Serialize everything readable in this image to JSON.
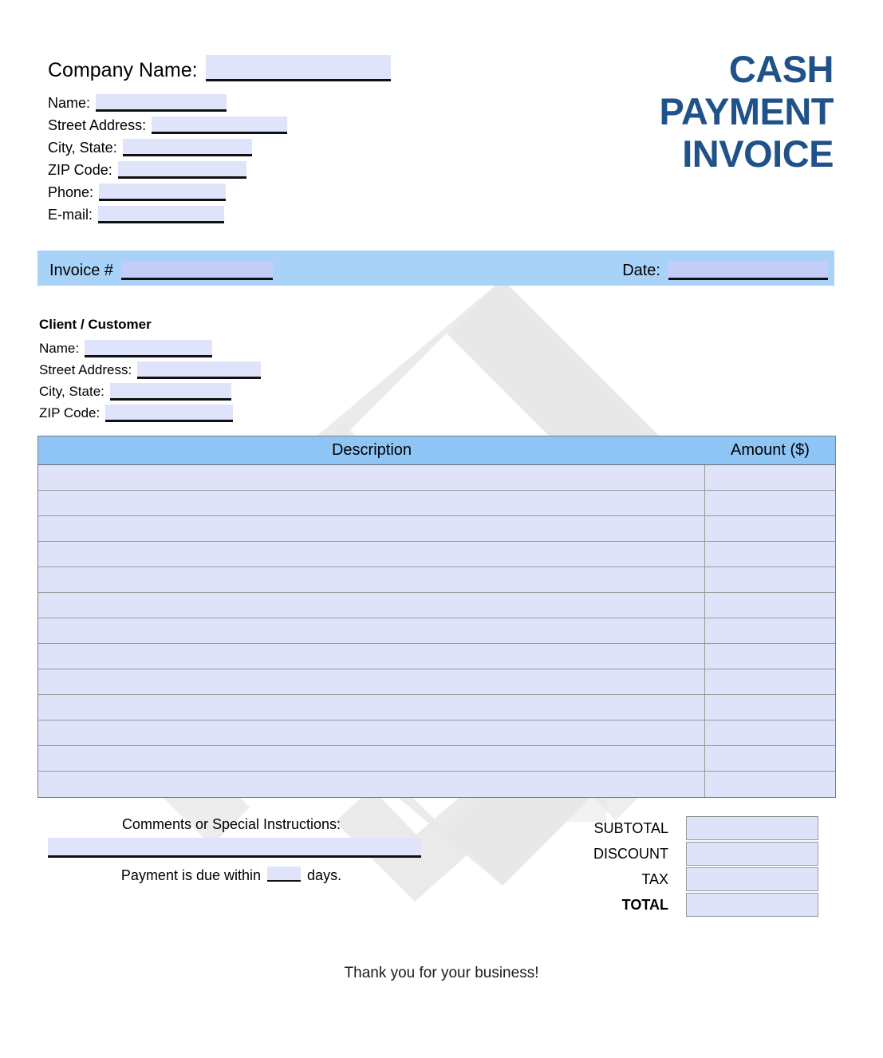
{
  "document": {
    "title_lines": [
      "CASH",
      "PAYMENT",
      "INVOICE"
    ],
    "title_color": "#1f5288",
    "accent_bar_color": "#a8d2f8",
    "table_header_color": "#8ec5f5",
    "field_fill_color": "#dfe4fb",
    "row_fill_color": "#dee3fa",
    "watermark": "chevron-diamond-logo"
  },
  "company": {
    "name_label": "Company Name:",
    "fields": [
      {
        "label": "Name:",
        "value": "",
        "placeholder": ""
      },
      {
        "label": "Street Address:",
        "value": "",
        "placeholder": ""
      },
      {
        "label": "City, State:",
        "value": "",
        "placeholder": ""
      },
      {
        "label": "ZIP Code:",
        "value": "",
        "placeholder": ""
      },
      {
        "label": "Phone:",
        "value": "",
        "placeholder": ""
      },
      {
        "label": "E-mail:",
        "value": "",
        "placeholder": ""
      }
    ]
  },
  "invoice_bar": {
    "number_label": "Invoice #",
    "number_value": "",
    "date_label": "Date:",
    "date_value": ""
  },
  "client": {
    "heading": "Client / Customer",
    "fields": [
      {
        "label": "Name:",
        "value": ""
      },
      {
        "label": "Street Address:",
        "value": ""
      },
      {
        "label": "City, State:",
        "value": ""
      },
      {
        "label": "ZIP Code:",
        "value": ""
      }
    ]
  },
  "items": {
    "columns": [
      "Description",
      "Amount ($)"
    ],
    "rows": [
      {
        "description": "",
        "amount": ""
      },
      {
        "description": "",
        "amount": ""
      },
      {
        "description": "",
        "amount": ""
      },
      {
        "description": "",
        "amount": ""
      },
      {
        "description": "",
        "amount": ""
      },
      {
        "description": "",
        "amount": ""
      },
      {
        "description": "",
        "amount": ""
      },
      {
        "description": "",
        "amount": ""
      },
      {
        "description": "",
        "amount": ""
      },
      {
        "description": "",
        "amount": ""
      },
      {
        "description": "",
        "amount": ""
      },
      {
        "description": "",
        "amount": ""
      },
      {
        "description": "",
        "amount": ""
      }
    ]
  },
  "comments": {
    "label": "Comments or Special Instructions:",
    "value": "",
    "due_prefix": "Payment is due within",
    "due_days": "",
    "due_suffix": "days."
  },
  "totals": {
    "rows": [
      {
        "label": "SUBTOTAL",
        "value": "",
        "bold": false
      },
      {
        "label": "DISCOUNT",
        "value": "",
        "bold": false
      },
      {
        "label": "TAX",
        "value": "",
        "bold": false
      },
      {
        "label": "TOTAL",
        "value": "",
        "bold": true
      }
    ]
  },
  "footer": {
    "note": "Thank you for your business!"
  }
}
